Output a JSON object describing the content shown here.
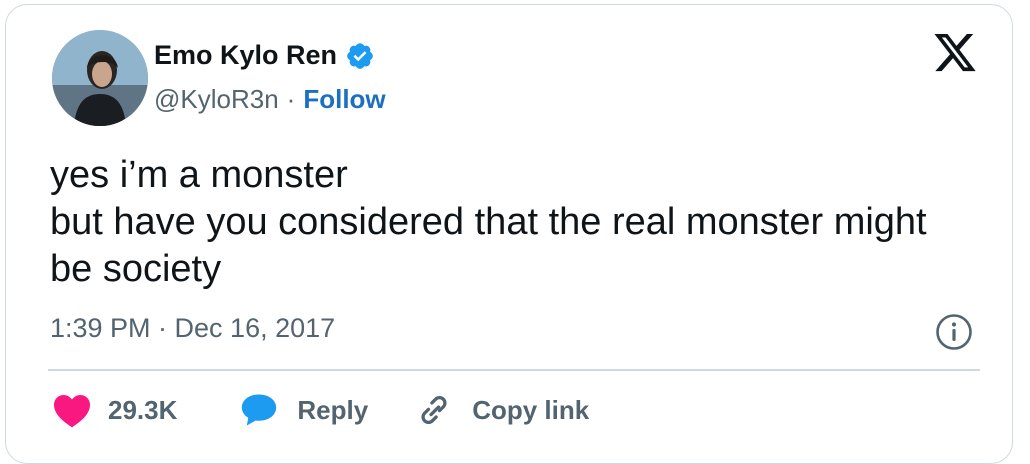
{
  "author": {
    "display_name": "Emo Kylo Ren",
    "handle": "@KyloR3n",
    "separator": "·",
    "follow_label": "Follow",
    "verified_color": "#1d9bf0"
  },
  "tweet": {
    "lines": [
      "yes i’m a monster",
      "but have you considered that the real monster might",
      "be society"
    ],
    "timestamp": "1:39 PM · Dec 16, 2017"
  },
  "actions": {
    "like_count": "29.3K",
    "reply_label": "Reply",
    "copy_link_label": "Copy link"
  },
  "icons": {
    "brand": "x-logo-icon",
    "info": "info-icon",
    "like": "heart-icon",
    "reply": "speech-bubble-icon",
    "copy": "link-icon"
  },
  "colors": {
    "heart": "#f91880",
    "reply_bubble": "#1d9bf0",
    "follow": "#1d6fc2",
    "muted": "#536471"
  }
}
